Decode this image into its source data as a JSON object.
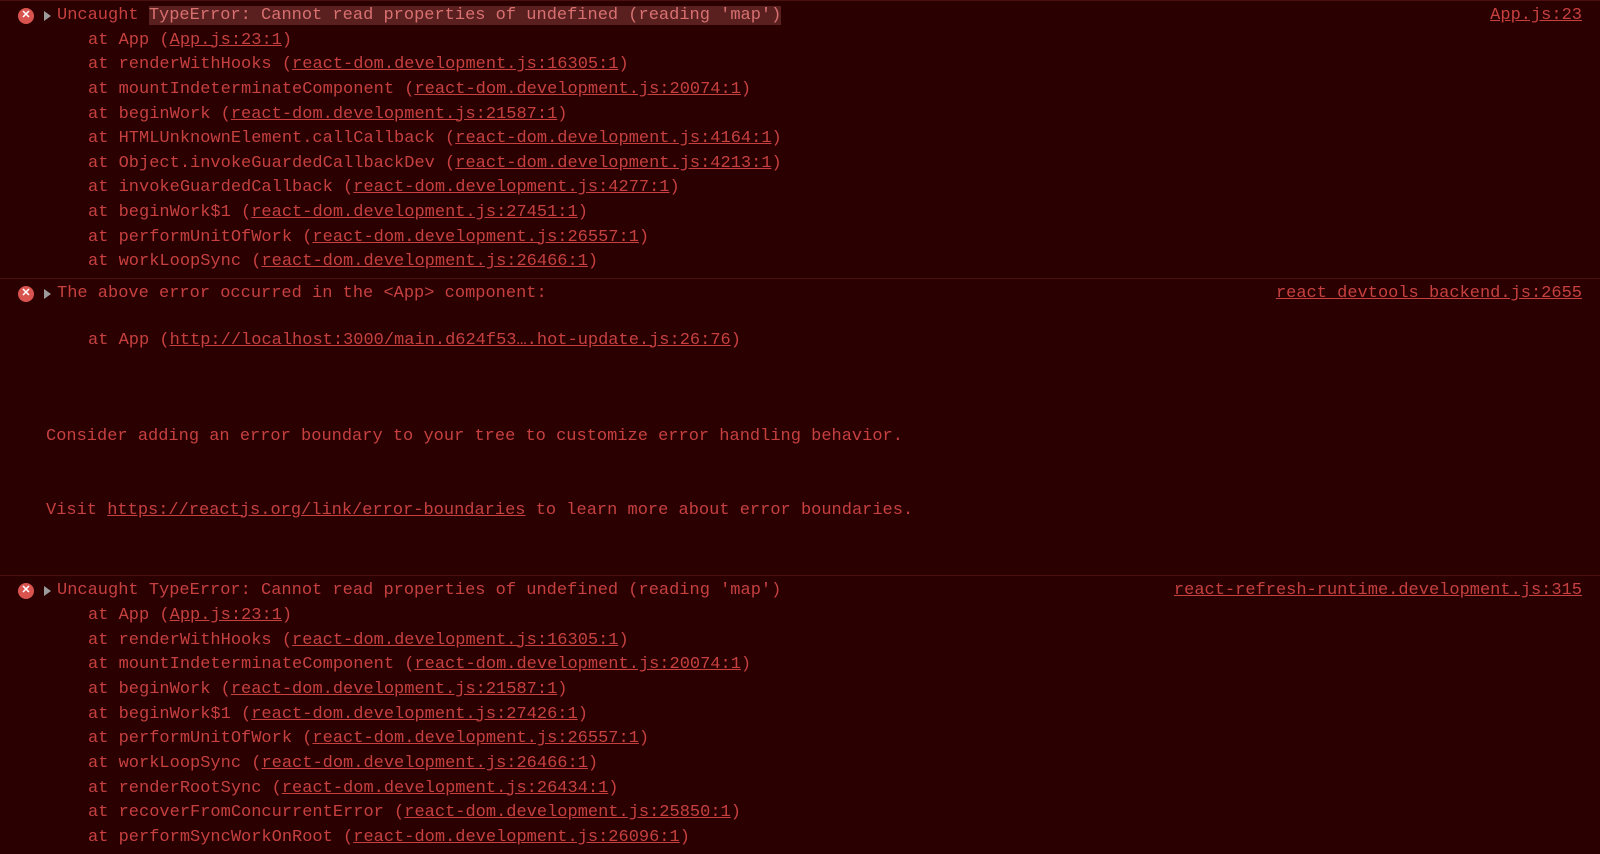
{
  "entries": [
    {
      "prefix": "Uncaught ",
      "highlighted_message": "TypeError: Cannot read properties of undefined (reading 'map')",
      "source": "App.js:23",
      "stack": [
        {
          "at": "at App (",
          "link": "App.js:23:1",
          "after": ")"
        },
        {
          "at": "at renderWithHooks (",
          "link": "react-dom.development.js:16305:1",
          "after": ")"
        },
        {
          "at": "at mountIndeterminateComponent (",
          "link": "react-dom.development.js:20074:1",
          "after": ")"
        },
        {
          "at": "at beginWork (",
          "link": "react-dom.development.js:21587:1",
          "after": ")"
        },
        {
          "at": "at HTMLUnknownElement.callCallback (",
          "link": "react-dom.development.js:4164:1",
          "after": ")"
        },
        {
          "at": "at Object.invokeGuardedCallbackDev (",
          "link": "react-dom.development.js:4213:1",
          "after": ")"
        },
        {
          "at": "at invokeGuardedCallback (",
          "link": "react-dom.development.js:4277:1",
          "after": ")"
        },
        {
          "at": "at beginWork$1 (",
          "link": "react-dom.development.js:27451:1",
          "after": ")"
        },
        {
          "at": "at performUnitOfWork (",
          "link": "react-dom.development.js:26557:1",
          "after": ")"
        },
        {
          "at": "at workLoopSync (",
          "link": "react-dom.development.js:26466:1",
          "after": ")"
        }
      ]
    },
    {
      "message": "The above error occurred in the <App> component:",
      "source": "react_devtools_backend.js:2655",
      "stack": [
        {
          "at": "at App (",
          "link": "http://localhost:3000/main.d624f53….hot-update.js:26:76",
          "after": ")"
        }
      ],
      "extra_line1": "Consider adding an error boundary to your tree to customize error handling behavior.",
      "extra_visit": "Visit ",
      "extra_link": "https://reactjs.org/link/error-boundaries",
      "extra_after": " to learn more about error boundaries."
    },
    {
      "message": "Uncaught TypeError: Cannot read properties of undefined (reading 'map')",
      "source": "react-refresh-runtime.development.js:315",
      "stack": [
        {
          "at": "at App (",
          "link": "App.js:23:1",
          "after": ")"
        },
        {
          "at": "at renderWithHooks (",
          "link": "react-dom.development.js:16305:1",
          "after": ")"
        },
        {
          "at": "at mountIndeterminateComponent (",
          "link": "react-dom.development.js:20074:1",
          "after": ")"
        },
        {
          "at": "at beginWork (",
          "link": "react-dom.development.js:21587:1",
          "after": ")"
        },
        {
          "at": "at beginWork$1 (",
          "link": "react-dom.development.js:27426:1",
          "after": ")"
        },
        {
          "at": "at performUnitOfWork (",
          "link": "react-dom.development.js:26557:1",
          "after": ")"
        },
        {
          "at": "at workLoopSync (",
          "link": "react-dom.development.js:26466:1",
          "after": ")"
        },
        {
          "at": "at renderRootSync (",
          "link": "react-dom.development.js:26434:1",
          "after": ")"
        },
        {
          "at": "at recoverFromConcurrentError (",
          "link": "react-dom.development.js:25850:1",
          "after": ")"
        },
        {
          "at": "at performSyncWorkOnRoot (",
          "link": "react-dom.development.js:26096:1",
          "after": ")"
        }
      ]
    }
  ]
}
